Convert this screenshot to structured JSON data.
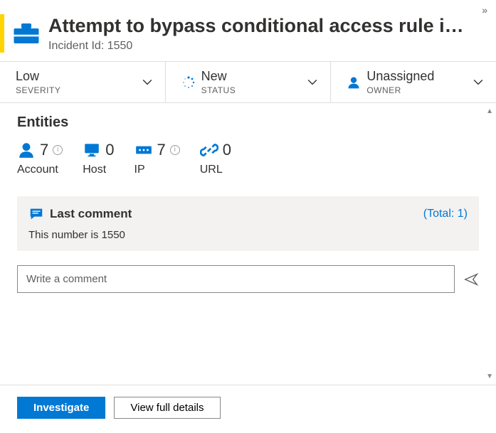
{
  "header": {
    "title": "Attempt to bypass conditional access rule i…",
    "subtitle_label": "Incident Id:",
    "incident_id": "1550"
  },
  "meta": {
    "severity": {
      "value": "Low",
      "label": "SEVERITY"
    },
    "status": {
      "value": "New",
      "label": "STATUS"
    },
    "owner": {
      "value": "Unassigned",
      "label": "OWNER"
    }
  },
  "entities": {
    "title": "Entities",
    "items": [
      {
        "icon": "user-icon",
        "count": "7",
        "info": true,
        "label": "Account"
      },
      {
        "icon": "monitor-icon",
        "count": "0",
        "info": false,
        "label": "Host"
      },
      {
        "icon": "ip-icon",
        "count": "7",
        "info": true,
        "label": "IP"
      },
      {
        "icon": "link-icon",
        "count": "0",
        "info": false,
        "label": "URL"
      }
    ]
  },
  "comments": {
    "heading": "Last comment",
    "total_label": "(Total: 1)",
    "last_text": "This number is 1550",
    "input_placeholder": "Write a comment"
  },
  "footer": {
    "investigate": "Investigate",
    "view_details": "View full details"
  }
}
